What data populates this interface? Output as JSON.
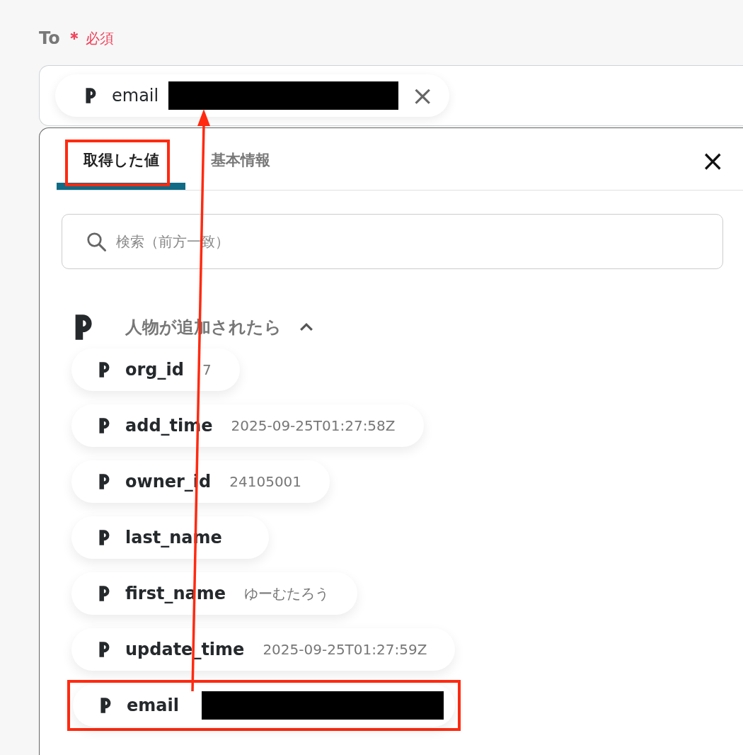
{
  "field": {
    "label": "To",
    "required_mark": "＊",
    "required_text": "必須",
    "chip": {
      "name": "email",
      "redacted": true,
      "remove": "×"
    }
  },
  "panel": {
    "tabs": [
      {
        "label": "取得した値",
        "selected": true,
        "highlighted": true
      },
      {
        "label": "基本情報",
        "selected": false,
        "highlighted": false
      }
    ],
    "close": "×",
    "search": {
      "placeholder": "検索（前方一致）"
    },
    "group": {
      "title": "人物が追加されたら",
      "expanded": true,
      "items": [
        {
          "name": "org_id",
          "value": "7",
          "redacted": false,
          "highlighted": false
        },
        {
          "name": "add_time",
          "value": "2025-09-25T01:27:58Z",
          "redacted": false,
          "highlighted": false
        },
        {
          "name": "owner_id",
          "value": "24105001",
          "redacted": false,
          "highlighted": false
        },
        {
          "name": "last_name",
          "redacted": false,
          "highlighted": false
        },
        {
          "name": "first_name",
          "value": "ゆーむたろう",
          "redacted": false,
          "highlighted": false
        },
        {
          "name": "update_time",
          "value": "2025-09-25T01:27:59Z",
          "redacted": false,
          "highlighted": false
        },
        {
          "name": "email",
          "redacted": true,
          "highlighted": true
        }
      ]
    }
  },
  "annotation": {
    "kind": "arrow"
  }
}
